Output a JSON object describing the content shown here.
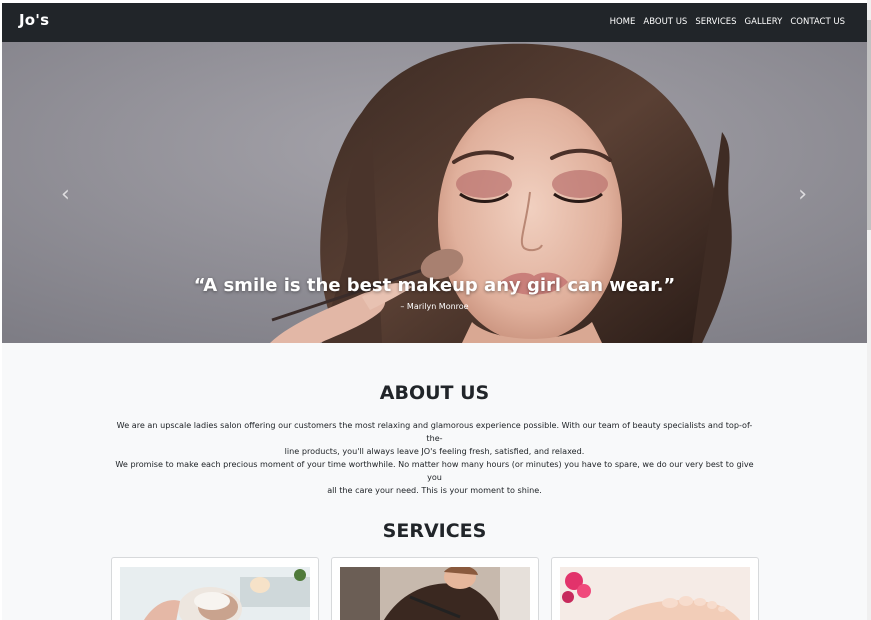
{
  "navbar": {
    "brand": "Jo's",
    "links": [
      "HOME",
      "ABOUT US",
      "SERVICES",
      "GALLERY",
      "CONTACT US"
    ]
  },
  "hero": {
    "quote": "“A smile is the best makeup any girl can wear.”",
    "author": "– Marilyn Monroe",
    "prev_icon": "chevron-left-icon",
    "next_icon": "chevron-right-icon"
  },
  "about": {
    "title": "ABOUT US",
    "line1": "We are an upscale ladies salon offering our customers the most relaxing and glamorous experience possible. With our team of beauty specialists and top-of-the-",
    "line2": "line products, you'll always leave JO's feeling fresh, satisfied, and relaxed.",
    "line3": "We promise to make each precious moment of your time worthwhile. No matter how many hours (or minutes) you have to spare, we do our very best to give you",
    "line4": "all the care your need. This is your moment to shine."
  },
  "services": {
    "title": "SERVICES",
    "cards": [
      "facial-treatment-image",
      "hair-styling-image",
      "pedicure-image"
    ]
  },
  "colors": {
    "navbar_bg": "#212529",
    "page_bg": "#f8f9fa",
    "text": "#212529"
  }
}
